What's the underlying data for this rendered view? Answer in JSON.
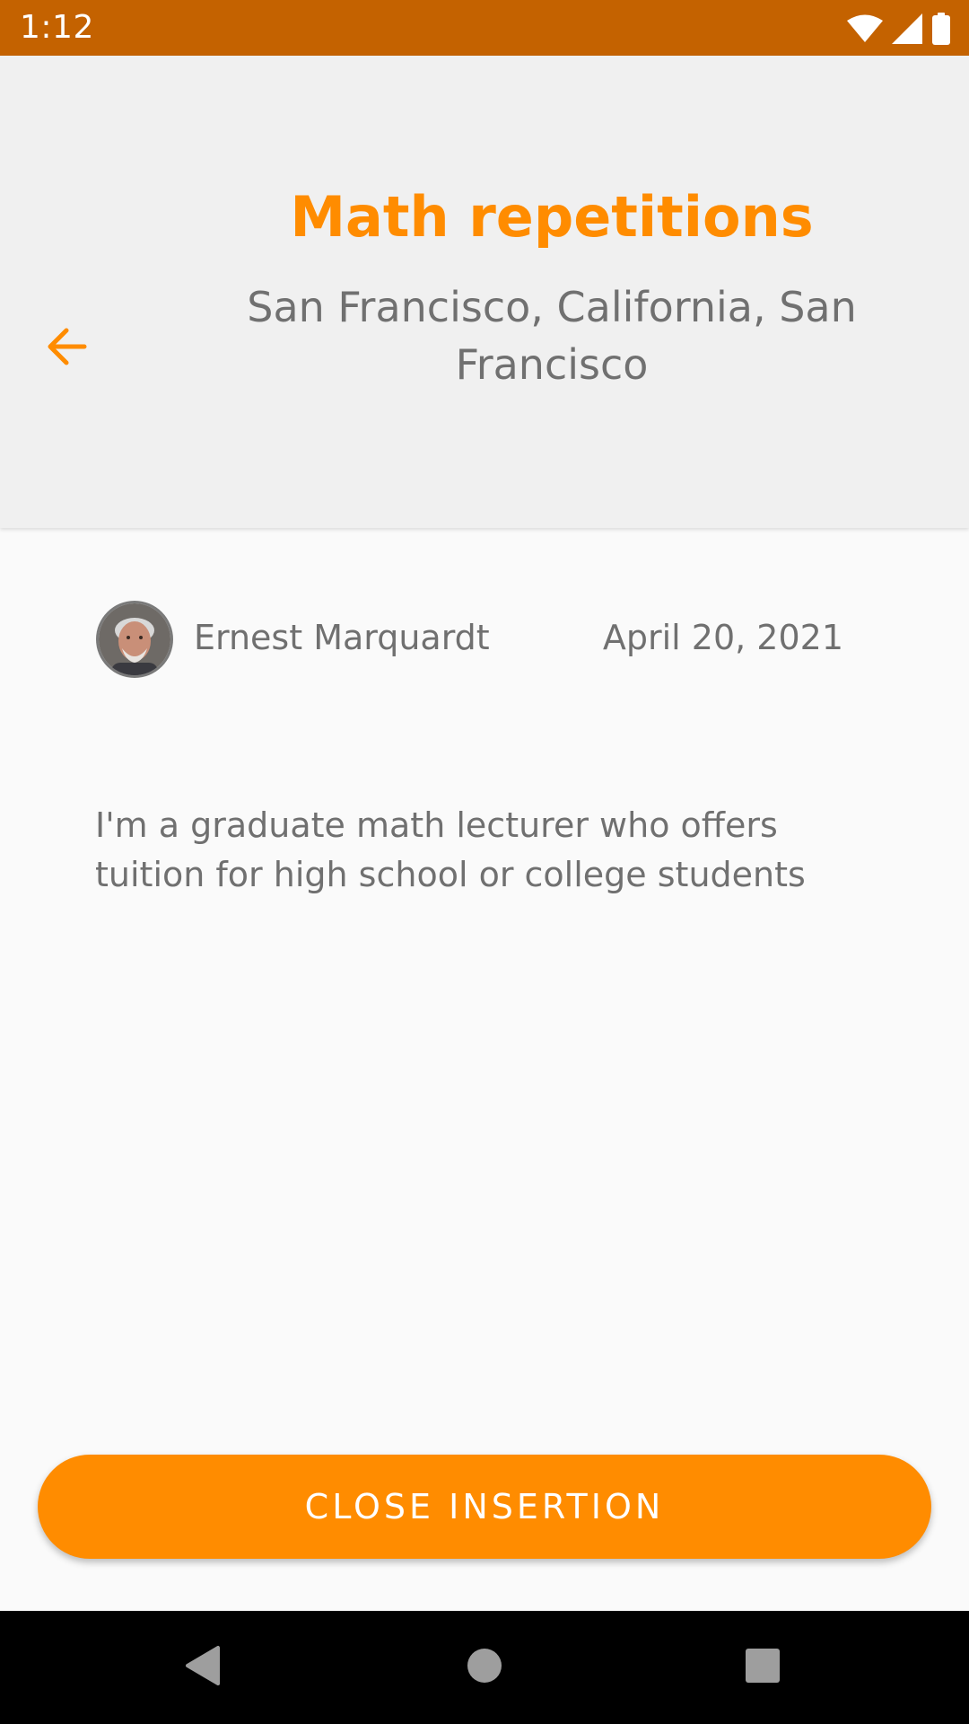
{
  "status_bar": {
    "time": "1:12",
    "color": "#c46200",
    "icons": [
      "wifi-icon",
      "signal-icon",
      "battery-icon"
    ]
  },
  "header": {
    "title": "Math repetitions",
    "subtitle": "San Francisco, California, San Francisco",
    "back_icon": "arrow-left-icon",
    "accent_color": "#ff8c00",
    "background": "#f0f0f0"
  },
  "post": {
    "author_name": "Ernest Marquardt",
    "date": "April 20, 2021",
    "description": "I'm a graduate math lecturer who offers tuition for high school or college students"
  },
  "actions": {
    "close_label": "CLOSE INSERTION",
    "button_color": "#ff8c00"
  },
  "nav_bar": {
    "icons": [
      "back-triangle-icon",
      "home-circle-icon",
      "recents-square-icon"
    ]
  }
}
